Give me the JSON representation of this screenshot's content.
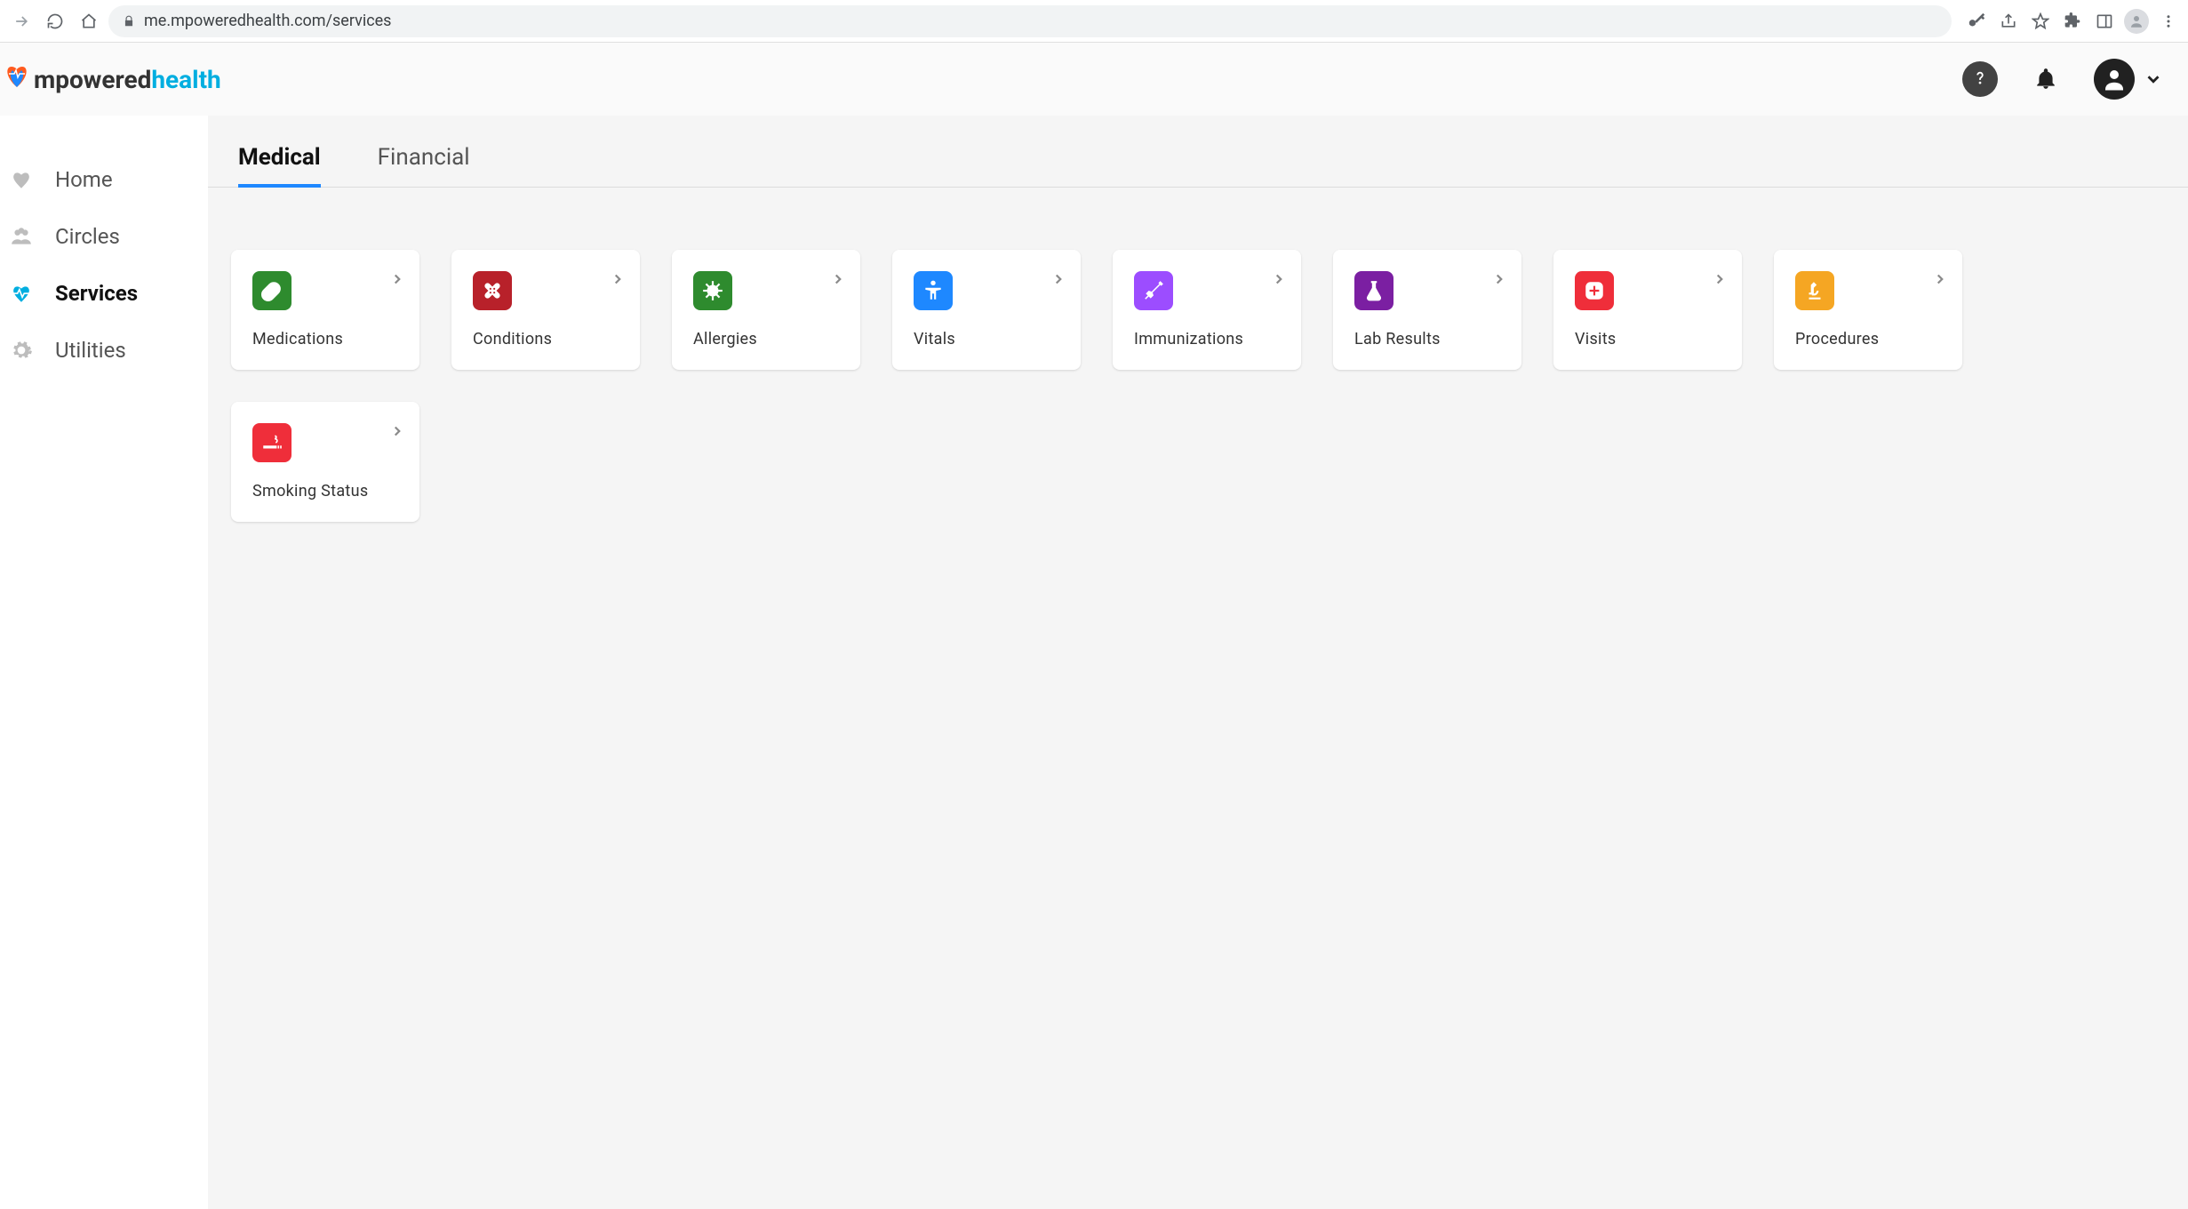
{
  "browser": {
    "url": "me.mpoweredhealth.com/services"
  },
  "brand": {
    "part1": "mpowered",
    "part2": "health"
  },
  "sidebar": {
    "items": [
      {
        "label": "Home",
        "icon": "heart",
        "active": false
      },
      {
        "label": "Circles",
        "icon": "people",
        "active": false
      },
      {
        "label": "Services",
        "icon": "ecg",
        "active": true
      },
      {
        "label": "Utilities",
        "icon": "gear",
        "active": false
      }
    ]
  },
  "tabs": [
    {
      "label": "Medical",
      "active": true
    },
    {
      "label": "Financial",
      "active": false
    }
  ],
  "cards": [
    {
      "label": "Medications",
      "icon": "pill",
      "color": "bg-green"
    },
    {
      "label": "Conditions",
      "icon": "bandage",
      "color": "bg-crimson"
    },
    {
      "label": "Allergies",
      "icon": "germ",
      "color": "bg-green2"
    },
    {
      "label": "Vitals",
      "icon": "body",
      "color": "bg-blue"
    },
    {
      "label": "Immunizations",
      "icon": "syringe",
      "color": "bg-violet"
    },
    {
      "label": "Lab Results",
      "icon": "flask",
      "color": "bg-purple"
    },
    {
      "label": "Visits",
      "icon": "plus",
      "color": "bg-red"
    },
    {
      "label": "Procedures",
      "icon": "microscope",
      "color": "bg-amber"
    },
    {
      "label": "Smoking Status",
      "icon": "smoke",
      "color": "bg-red"
    }
  ]
}
